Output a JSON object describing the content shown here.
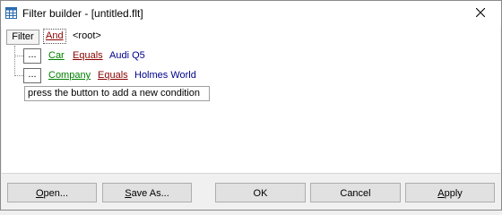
{
  "window": {
    "title": "Filter builder - [untitled.flt]",
    "icon": "grid-icon",
    "close_glyph": "✕"
  },
  "editor": {
    "filter_button_label": "Filter",
    "group_operator": "And",
    "root_label": "<root>",
    "conditions": [
      {
        "ellipsis": "...",
        "field": "Car",
        "operator": "Equals",
        "value": "Audi Q5"
      },
      {
        "ellipsis": "...",
        "field": "Company",
        "operator": "Equals",
        "value": "Holmes World"
      }
    ],
    "add_hint": "press the button to add a new condition"
  },
  "buttons": {
    "open": {
      "first": "O",
      "rest": "pen..."
    },
    "save_as": {
      "first": "S",
      "rest": "ave As..."
    },
    "ok": "OK",
    "cancel": "Cancel",
    "apply": {
      "first": "A",
      "rest": "pply"
    }
  },
  "colors": {
    "operator": "#8b0000",
    "field": "#008000",
    "value": "#00008b"
  }
}
